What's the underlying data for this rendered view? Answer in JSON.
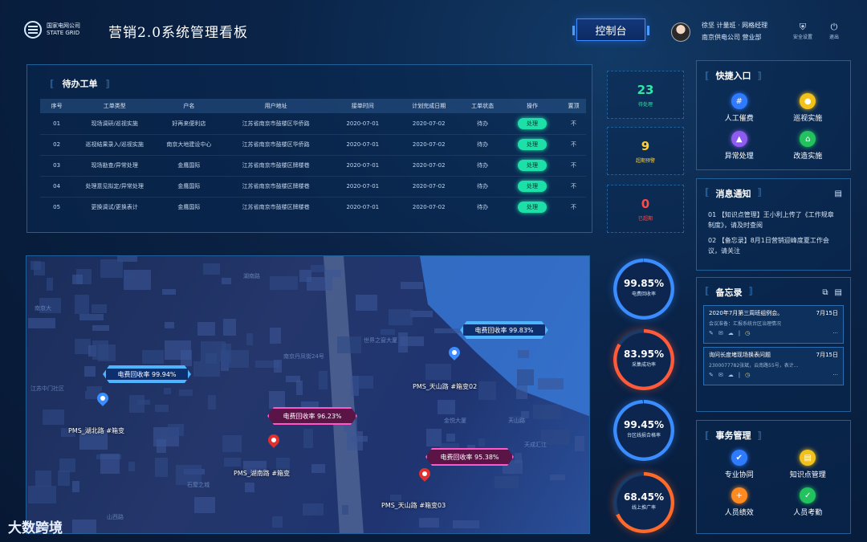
{
  "header": {
    "logo_line1": "国家电网公司",
    "logo_line2": "STATE GRID",
    "title": "营销2.0系统管理看板",
    "control_label": "控制台",
    "user_line1": "徐坚  计量班 · 网格经理",
    "user_line2": "南京供电公司  营业部",
    "icon_settings_label": "安全设置",
    "icon_logout_label": "退出"
  },
  "todo": {
    "title": "待办工单",
    "columns": [
      "序号",
      "工单类型",
      "户名",
      "用户地址",
      "接单时间",
      "计划完成日期",
      "工单状态",
      "操作",
      "置顶"
    ],
    "rows": [
      {
        "no": "01",
        "type": "现场调研/巡视实施",
        "name": "好再来便利店",
        "addr": "江苏省南京市鼓楼区华侨路",
        "recv": "2020-07-01",
        "plan": "2020-07-02",
        "status": "待办",
        "action": "处理",
        "top": "不"
      },
      {
        "no": "02",
        "type": "巡视结果录入/巡视实施",
        "name": "南京大地建设中心",
        "addr": "江苏省南京市鼓楼区华侨路",
        "recv": "2020-07-01",
        "plan": "2020-07-02",
        "status": "待办",
        "action": "处理",
        "top": "不"
      },
      {
        "no": "03",
        "type": "现场勘查/异常处理",
        "name": "金鹰国际",
        "addr": "江苏省南京市鼓楼区牌楼巷",
        "recv": "2020-07-01",
        "plan": "2020-07-02",
        "status": "待办",
        "action": "处理",
        "top": "不"
      },
      {
        "no": "04",
        "type": "处理意见拟定/异常处理",
        "name": "金鹰国际",
        "addr": "江苏省南京市鼓楼区牌楼巷",
        "recv": "2020-07-01",
        "plan": "2020-07-02",
        "status": "待办",
        "action": "处理",
        "top": "不"
      },
      {
        "no": "05",
        "type": "更换调试/更换表计",
        "name": "金鹰国际",
        "addr": "江苏省南京市鼓楼区牌楼巷",
        "recv": "2020-07-01",
        "plan": "2020-07-02",
        "status": "待办",
        "action": "处理",
        "top": "不"
      }
    ]
  },
  "stats": [
    {
      "value": "23",
      "label": "待处理",
      "color": "#2ee6a6"
    },
    {
      "value": "9",
      "label": "超期预警",
      "color": "#ffcf2e"
    },
    {
      "value": "0",
      "label": "已超期",
      "color": "#ff4a4a"
    }
  ],
  "rings": [
    {
      "value": "99.85%",
      "label": "电费回收率",
      "color": "#3a8cff",
      "fraction": 0.9985
    },
    {
      "value": "83.95%",
      "label": "采集成功率",
      "color": "#ff5a3a",
      "fraction": 0.8395
    },
    {
      "value": "99.45%",
      "label": "台区线损合格率",
      "color": "#3a8cff",
      "fraction": 0.9945
    },
    {
      "value": "68.45%",
      "label": "线上推广率",
      "color": "#ff6a2a",
      "fraction": 0.6845
    }
  ],
  "quick": {
    "title": "快捷入口",
    "items": [
      {
        "label": "人工催费",
        "color": "#2f7bff",
        "glyph": "#"
      },
      {
        "label": "巡视实施",
        "color": "#f2c21b",
        "glyph": "●"
      },
      {
        "label": "异常处理",
        "color": "#8e5cf0",
        "glyph": "▲"
      },
      {
        "label": "改造实施",
        "color": "#22c35e",
        "glyph": "⌂"
      }
    ]
  },
  "notice": {
    "title": "消息通知",
    "items": [
      "01  【知识点管理】王小利上传了《工作规章制度》，请及时查阅",
      "02  【备忘录】8月1日营销迎峰度夏工作会议，请关注"
    ]
  },
  "memo": {
    "title": "备忘录",
    "cards": [
      {
        "title": "2020年7月第三周班组例会。",
        "date": "7月15日",
        "sub": "会议准备：汇报系统台区治理情况"
      },
      {
        "title": "询问长度堵现场换表问题",
        "date": "7月15日",
        "sub": "2300077782张斌，云南路55号，表计..."
      }
    ]
  },
  "affairs": {
    "title": "事务管理",
    "items": [
      {
        "label": "专业协同",
        "color": "#2f7bff",
        "glyph": "✔"
      },
      {
        "label": "知识点管理",
        "color": "#f2c21b",
        "glyph": "▤"
      },
      {
        "label": "人员绩效",
        "color": "#ff8a1f",
        "glyph": "+"
      },
      {
        "label": "人员考勤",
        "color": "#22c35e",
        "glyph": "✓"
      }
    ]
  },
  "map": {
    "tags": [
      {
        "label": "电费回收率  99.94%",
        "style": "blue"
      },
      {
        "label": "电费回收率  96.23%",
        "style": "pink"
      },
      {
        "label": "电费回收率  99.83%",
        "style": "blue"
      },
      {
        "label": "电费回收率  95.38%",
        "style": "pink"
      }
    ],
    "points": [
      {
        "label": "PMS_湖北路 #箱变",
        "color": "#3a8cff"
      },
      {
        "label": "PMS_湖南路 #箱变",
        "color": "#e03030"
      },
      {
        "label": "PMS_天山路 #箱变02",
        "color": "#3a8cff"
      },
      {
        "label": "PMS_天山路 #箱变03",
        "color": "#e03030"
      }
    ],
    "street_labels": [
      "南京大",
      "湖南路",
      "南京丹凤街24号",
      "江苏中门社区",
      "世界之窗大厦",
      "石屋之城",
      "天山路",
      "金悦大厦",
      "天成汇江",
      "山西路"
    ]
  },
  "watermark": "大数跨境"
}
